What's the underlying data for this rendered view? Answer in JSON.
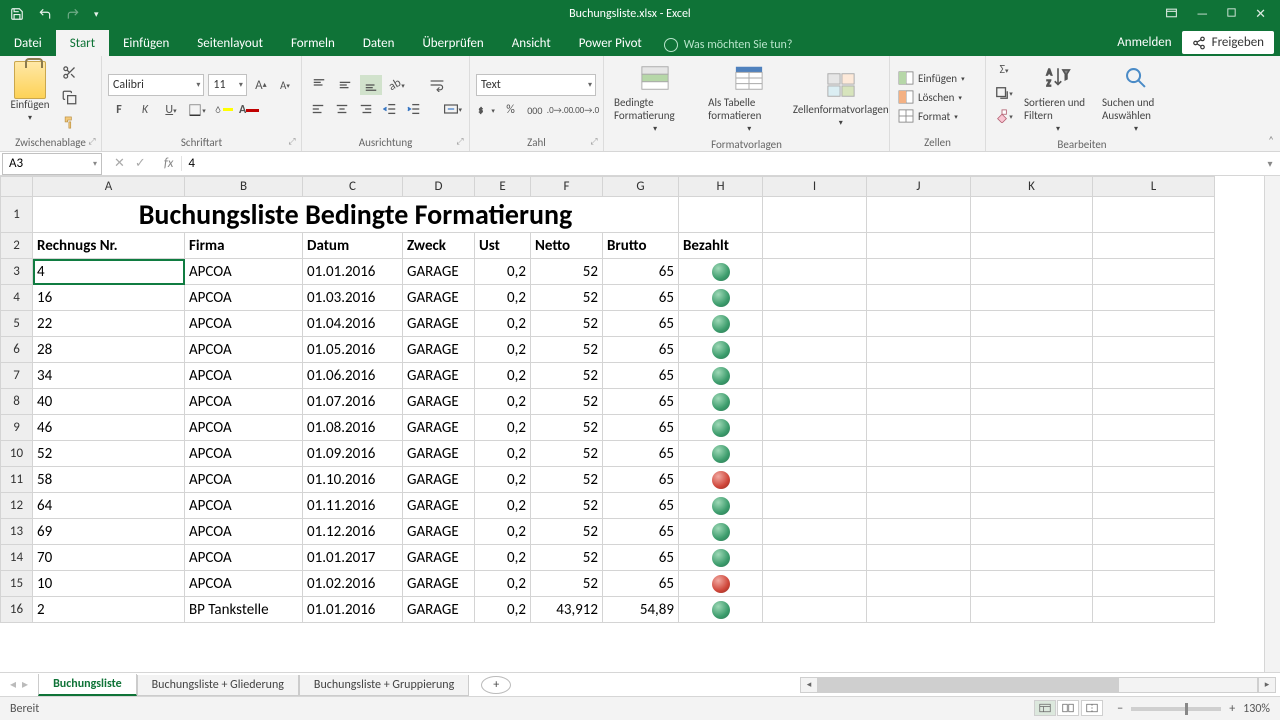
{
  "titlebar": {
    "title": "Buchungsliste.xlsx - Excel"
  },
  "ribbon": {
    "tabs": [
      "Datei",
      "Start",
      "Einfügen",
      "Seitenlayout",
      "Formeln",
      "Daten",
      "Überprüfen",
      "Ansicht",
      "Power Pivot"
    ],
    "active_tab": "Start",
    "tell_me": "Was möchten Sie tun?",
    "signin": "Anmelden",
    "share": "Freigeben",
    "groups": {
      "clipboard": {
        "label": "Zwischenablage",
        "paste": "Einfügen"
      },
      "font": {
        "label": "Schriftart",
        "name": "Calibri",
        "size": "11"
      },
      "alignment": {
        "label": "Ausrichtung"
      },
      "number": {
        "label": "Zahl",
        "format": "Text"
      },
      "styles": {
        "label": "Formatvorlagen",
        "cond": "Bedingte Formatierung",
        "astable": "Als Tabelle formatieren",
        "cellstyles": "Zellenformatvorlagen"
      },
      "cells": {
        "label": "Zellen",
        "insert": "Einfügen",
        "delete": "Löschen",
        "format": "Format"
      },
      "editing": {
        "label": "Bearbeiten",
        "sort": "Sortieren und Filtern",
        "find": "Suchen und Auswählen"
      }
    }
  },
  "formula_bar": {
    "name": "A3",
    "value": "4"
  },
  "sheet": {
    "columns": [
      "A",
      "B",
      "C",
      "D",
      "E",
      "F",
      "G",
      "H",
      "I",
      "J",
      "K",
      "L"
    ],
    "title": "Buchungsliste Bedingte Formatierung",
    "headers": [
      "Rechnugs Nr.",
      "Firma",
      "Datum",
      "Zweck",
      "Ust",
      "Netto",
      "Brutto",
      "Bezahlt"
    ],
    "rows": [
      {
        "n": 3,
        "a": "4",
        "b": "APCOA",
        "c": "01.01.2016",
        "d": "GARAGE",
        "e": "0,2",
        "f": "52",
        "g": "65",
        "h": "green"
      },
      {
        "n": 4,
        "a": "16",
        "b": "APCOA",
        "c": "01.03.2016",
        "d": "GARAGE",
        "e": "0,2",
        "f": "52",
        "g": "65",
        "h": "green"
      },
      {
        "n": 5,
        "a": "22",
        "b": "APCOA",
        "c": "01.04.2016",
        "d": "GARAGE",
        "e": "0,2",
        "f": "52",
        "g": "65",
        "h": "green"
      },
      {
        "n": 6,
        "a": "28",
        "b": "APCOA",
        "c": "01.05.2016",
        "d": "GARAGE",
        "e": "0,2",
        "f": "52",
        "g": "65",
        "h": "green"
      },
      {
        "n": 7,
        "a": "34",
        "b": "APCOA",
        "c": "01.06.2016",
        "d": "GARAGE",
        "e": "0,2",
        "f": "52",
        "g": "65",
        "h": "green"
      },
      {
        "n": 8,
        "a": "40",
        "b": "APCOA",
        "c": "01.07.2016",
        "d": "GARAGE",
        "e": "0,2",
        "f": "52",
        "g": "65",
        "h": "green"
      },
      {
        "n": 9,
        "a": "46",
        "b": "APCOA",
        "c": "01.08.2016",
        "d": "GARAGE",
        "e": "0,2",
        "f": "52",
        "g": "65",
        "h": "green"
      },
      {
        "n": 10,
        "a": "52",
        "b": "APCOA",
        "c": "01.09.2016",
        "d": "GARAGE",
        "e": "0,2",
        "f": "52",
        "g": "65",
        "h": "green"
      },
      {
        "n": 11,
        "a": "58",
        "b": "APCOA",
        "c": "01.10.2016",
        "d": "GARAGE",
        "e": "0,2",
        "f": "52",
        "g": "65",
        "h": "red"
      },
      {
        "n": 12,
        "a": "64",
        "b": "APCOA",
        "c": "01.11.2016",
        "d": "GARAGE",
        "e": "0,2",
        "f": "52",
        "g": "65",
        "h": "green"
      },
      {
        "n": 13,
        "a": "69",
        "b": "APCOA",
        "c": "01.12.2016",
        "d": "GARAGE",
        "e": "0,2",
        "f": "52",
        "g": "65",
        "h": "green"
      },
      {
        "n": 14,
        "a": "70",
        "b": "APCOA",
        "c": "01.01.2017",
        "d": "GARAGE",
        "e": "0,2",
        "f": "52",
        "g": "65",
        "h": "green"
      },
      {
        "n": 15,
        "a": "10",
        "b": "APCOA",
        "c": "01.02.2016",
        "d": "GARAGE",
        "e": "0,2",
        "f": "52",
        "g": "65",
        "h": "red"
      },
      {
        "n": 16,
        "a": "2",
        "b": "BP Tankstelle",
        "c": "01.01.2016",
        "d": "GARAGE",
        "e": "0,2",
        "f": "43,912",
        "g": "54,89",
        "h": "green"
      }
    ]
  },
  "sheet_tabs": {
    "items": [
      "Buchungsliste",
      "Buchungsliste + Gliederung",
      "Buchungsliste + Gruppierung"
    ],
    "active": 0
  },
  "status": {
    "ready": "Bereit",
    "zoom": "130%"
  }
}
